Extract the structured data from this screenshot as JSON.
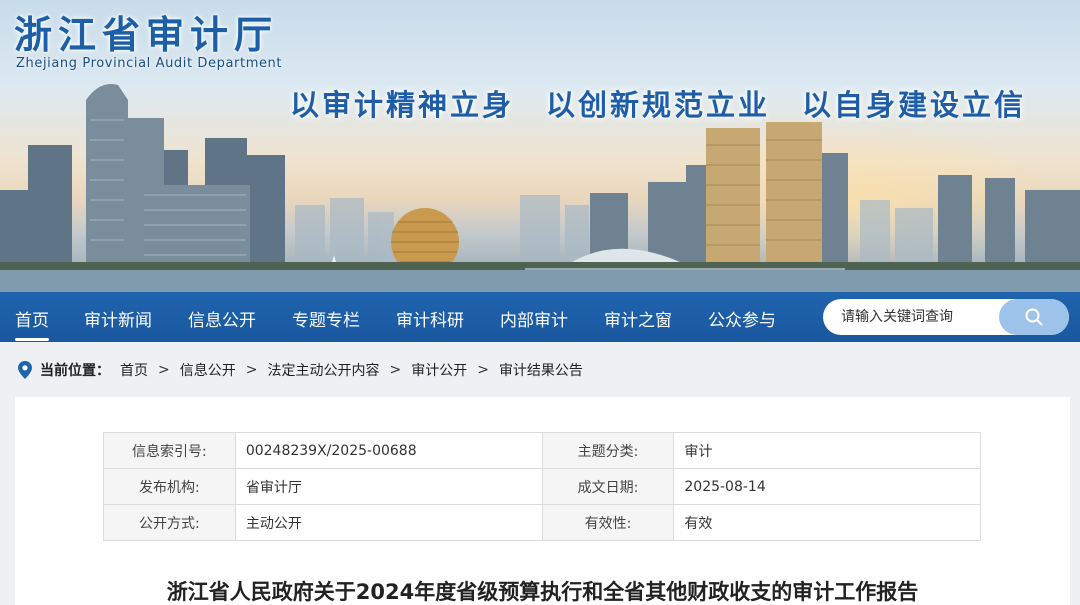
{
  "header": {
    "site_title": "浙江省审计厅",
    "site_subtitle": "Zhejiang Provincial Audit Department",
    "slogan": "以审计精神立身　以创新规范立业　以自身建设立信"
  },
  "nav": {
    "items": [
      {
        "label": "首页",
        "active": true
      },
      {
        "label": "审计新闻"
      },
      {
        "label": "信息公开"
      },
      {
        "label": "专题专栏"
      },
      {
        "label": "审计科研"
      },
      {
        "label": "内部审计"
      },
      {
        "label": "审计之窗"
      },
      {
        "label": "公众参与"
      }
    ]
  },
  "search": {
    "placeholder": "请输入关键词查询",
    "icon": "search-icon"
  },
  "breadcrumb": {
    "label": "当前位置：",
    "items": [
      "首页",
      "信息公开",
      "法定主动公开内容",
      "审计公开",
      "审计结果公告"
    ],
    "separator": ">",
    "icon": "location-pin-icon"
  },
  "meta": {
    "rows": [
      {
        "k1": "信息索引号:",
        "v1": "00248239X/2025-00688",
        "k2": "主题分类:",
        "v2": "审计"
      },
      {
        "k1": "发布机构:",
        "v1": "省审计厅",
        "k2": "成文日期:",
        "v2": "2025-08-14"
      },
      {
        "k1": "公开方式:",
        "v1": "主动公开",
        "k2": "有效性:",
        "v2": "有效"
      }
    ]
  },
  "article": {
    "title": "浙江省人民政府关于2024年度省级预算执行和全省其他财政收支的审计工作报告"
  },
  "colors": {
    "nav_bg": "#1f64ad",
    "title_blue": "#1d5fa6",
    "search_button": "#9dc3ea"
  }
}
